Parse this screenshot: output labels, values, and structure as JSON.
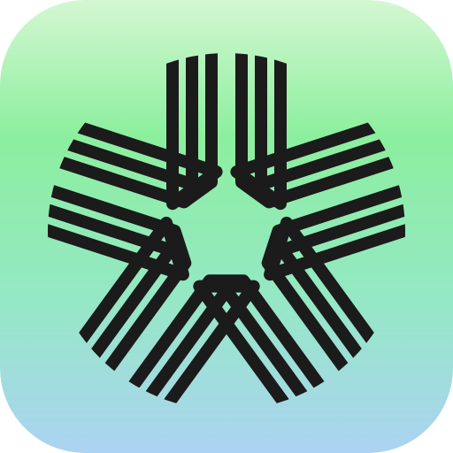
{
  "icon": {
    "name": "star-stripes-logo-icon",
    "colors": {
      "gradient_top": "#d4f7d2",
      "gradient_upper": "#8cef9e",
      "gradient_lower": "#94e8c4",
      "gradient_bottom": "#abd3f2",
      "stroke": "#1b1b1b"
    }
  }
}
